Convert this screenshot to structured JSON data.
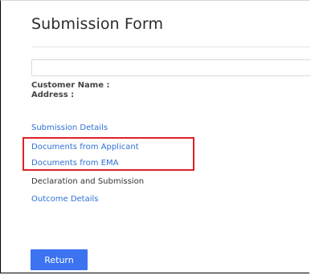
{
  "form": {
    "title": "Submission Form",
    "search_value": "",
    "customer_name_label": "Customer Name :",
    "address_label": "Address :"
  },
  "nav": {
    "items": [
      {
        "label": "Submission Details"
      },
      {
        "label": "Documents from Applicant"
      },
      {
        "label": "Documents from EMA"
      },
      {
        "label": "Declaration and Submission"
      },
      {
        "label": "Outcome Details"
      }
    ]
  },
  "actions": {
    "return_label": "Return"
  },
  "colors": {
    "link": "#2f6fd6",
    "highlight_border": "#e0202a",
    "button_bg": "#3b73f0"
  }
}
